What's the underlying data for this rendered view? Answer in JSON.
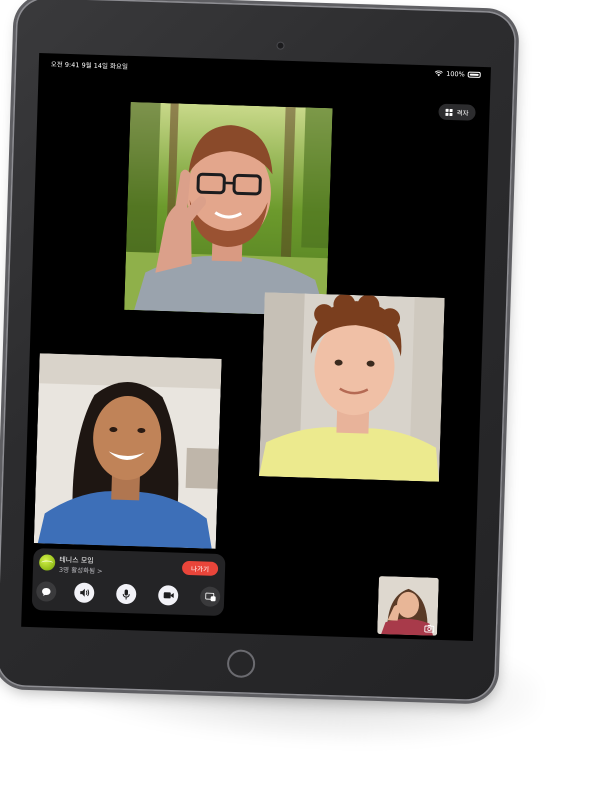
{
  "status_bar": {
    "time_date": "오전 9:41   9월 14일 화요일",
    "battery": "100%"
  },
  "layout_button": {
    "label": "격자",
    "icon": "grid-icon"
  },
  "call": {
    "group_name": "테니스 모임",
    "status": "3명 활성화됨 >",
    "leave_label": "나가기",
    "controls": [
      "message-icon",
      "speaker-icon",
      "microphone-icon",
      "camera-icon",
      "share-screen-icon"
    ]
  },
  "colors": {
    "leave_red": "#e9453a",
    "panel_bg": "#262628",
    "screen_bg": "#000000",
    "device_frame": "#2c2c2e"
  }
}
